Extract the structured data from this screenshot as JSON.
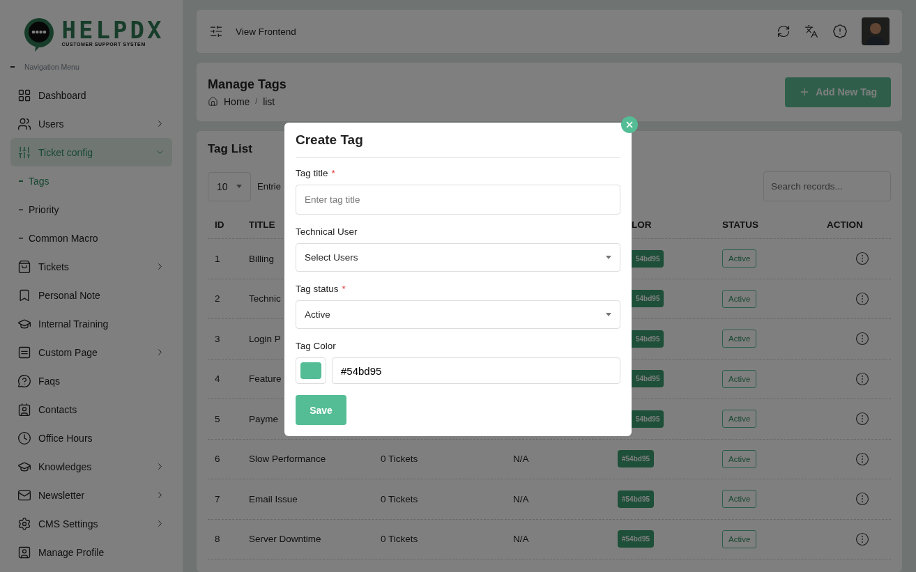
{
  "logo": {
    "name": "HELPDX",
    "tagline": "CUSTOMER SUPPORT SYSTEM"
  },
  "sidebar": {
    "heading": "Navigation Menu",
    "items": [
      {
        "label": "Dashboard",
        "selected": false,
        "expandable": false
      },
      {
        "label": "Users",
        "selected": false,
        "expandable": true,
        "expanded": false
      },
      {
        "label": "Ticket config",
        "selected": true,
        "expandable": true,
        "expanded": true,
        "children": [
          {
            "label": "Tags",
            "selected": true
          },
          {
            "label": "Priority",
            "selected": false
          },
          {
            "label": "Common Macro",
            "selected": false
          }
        ]
      },
      {
        "label": "Tickets",
        "selected": false,
        "expandable": true,
        "expanded": false
      },
      {
        "label": "Personal Note",
        "selected": false,
        "expandable": false
      },
      {
        "label": "Internal Training",
        "selected": false,
        "expandable": false
      },
      {
        "label": "Custom Page",
        "selected": false,
        "expandable": true,
        "expanded": false
      },
      {
        "label": "Faqs",
        "selected": false,
        "expandable": false
      },
      {
        "label": "Contacts",
        "selected": false,
        "expandable": false
      },
      {
        "label": "Office Hours",
        "selected": false,
        "expandable": false
      },
      {
        "label": "Knowledges",
        "selected": false,
        "expandable": true,
        "expanded": false
      },
      {
        "label": "Newsletter",
        "selected": false,
        "expandable": true,
        "expanded": false
      },
      {
        "label": "CMS Settings",
        "selected": false,
        "expandable": true,
        "expanded": false
      },
      {
        "label": "Manage Profile",
        "selected": false,
        "expandable": false
      }
    ]
  },
  "topbar": {
    "link": "View Frontend"
  },
  "page_header": {
    "title": "Manage Tags",
    "breadcrumb": [
      "Home",
      "list"
    ],
    "breadcrumb_separator": "/",
    "add_button": "Add New Tag"
  },
  "tag_list": {
    "title": "Tag List",
    "page_size": "10",
    "entries_label": "Entrie",
    "search": {
      "placeholder": "Search records..."
    },
    "columns": [
      "ID",
      "TITLE",
      "",
      "",
      "LOR",
      "STATUS",
      "ACTION"
    ],
    "rows": [
      {
        "id": "1",
        "title": "Billing",
        "color_text": "54bd95",
        "status": "Active"
      },
      {
        "id": "2",
        "title": "Technic",
        "color_text": "54bd95",
        "status": "Active"
      },
      {
        "id": "3",
        "title": "Login P",
        "color_text": "54bd95",
        "status": "Active"
      },
      {
        "id": "4",
        "title": "Feature",
        "color_text": "54bd95",
        "status": "Active"
      },
      {
        "id": "5",
        "title": "Payme",
        "color_text": "54bd95",
        "status": "Active"
      },
      {
        "id": "6",
        "title": "Slow Performance",
        "tickets": "0 Tickets",
        "assignee": "N/A",
        "color_text": "#54bd95",
        "status": "Active"
      },
      {
        "id": "7",
        "title": "Email Issue",
        "tickets": "0 Tickets",
        "assignee": "N/A",
        "color_text": "#54bd95",
        "status": "Active"
      },
      {
        "id": "8",
        "title": "Server Downtime",
        "tickets": "0 Tickets",
        "assignee": "N/A",
        "color_text": "#54bd95",
        "status": "Active"
      }
    ]
  },
  "modal": {
    "title": "Create Tag",
    "required_mark": "*",
    "fields": [
      {
        "kind": "text",
        "label": "Tag title",
        "required": true,
        "placeholder": "Enter tag title"
      },
      {
        "kind": "select",
        "label": "Technical User",
        "required": false,
        "value": "Select Users"
      },
      {
        "kind": "select",
        "label": "Tag status",
        "required": true,
        "value": "Active"
      },
      {
        "kind": "color",
        "label": "Tag Color",
        "required": false,
        "value": "#54bd95",
        "color": "#54bd95"
      }
    ],
    "save_button": "Save"
  }
}
